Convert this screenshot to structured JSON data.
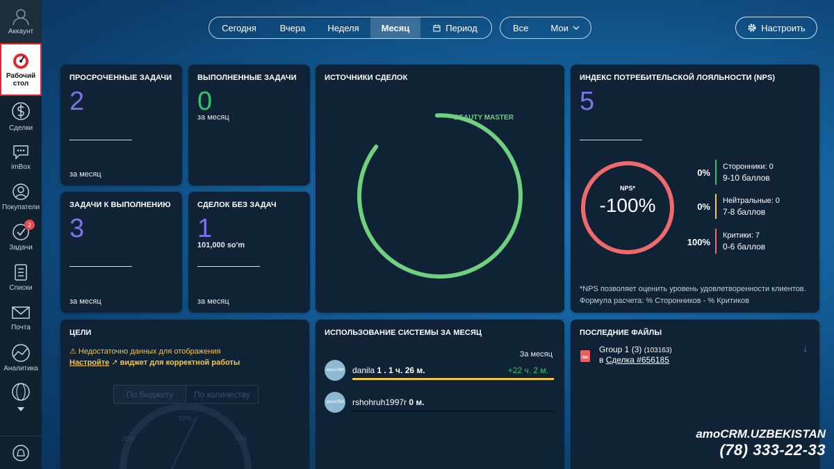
{
  "sidebar": {
    "account_label": "Аккаунт",
    "dashboard_label": "Рабочий\nстол",
    "deals_label": "Сделки",
    "imbox_label": "imBox",
    "buyers_label": "Покупатели",
    "tasks_label": "Задачи",
    "tasks_badge": "2",
    "lists_label": "Списки",
    "mail_label": "Почта",
    "analytics_label": "Аналитика"
  },
  "topbar": {
    "periods": [
      "Сегодня",
      "Вчера",
      "Неделя",
      "Месяц",
      "Период"
    ],
    "active_period": "Месяц",
    "filter_all": "Все",
    "filter_mine": "Мои",
    "settings_label": "Настроить"
  },
  "widgets": {
    "overdue": {
      "title": "ПРОСРОЧЕННЫЕ ЗАДАЧИ",
      "value": "2",
      "footer": "за месяц"
    },
    "completed": {
      "title": "ВЫПОЛНЕННЫЕ ЗАДАЧИ",
      "value": "0",
      "subtitle": "за месяц"
    },
    "to_do": {
      "title": "ЗАДАЧИ К ВЫПОЛНЕНИЮ",
      "value": "3",
      "footer": "за месяц"
    },
    "no_tasks": {
      "title": "СДЕЛОК БЕЗ ЗАДАЧ",
      "value": "1",
      "amount": "101,000 so'm",
      "footer": "за месяц"
    },
    "sources": {
      "title": "ИСТОЧНИКИ СДЕЛОК",
      "ring_label": "BEAUTY MASTER",
      "ring_share": 0.86,
      "ring_color": "#6fd07e"
    },
    "nps": {
      "title": "ИНДЕКС ПОТРЕБИТЕЛЬСКОЙ ЛОЯЛЬНОСТИ (NPS)",
      "value": "5",
      "gauge_label": "NPS*",
      "gauge_value": "-100%",
      "rows": [
        {
          "pct": "0%",
          "name": "Сторонники: 0",
          "range": "9-10 баллов",
          "color": "#33c76d"
        },
        {
          "pct": "0%",
          "name": "Нейтральные: 0",
          "range": "7-8 баллов",
          "color": "#f2c94c"
        },
        {
          "pct": "100%",
          "name": "Критики: 7",
          "range": "0-6 баллов",
          "color": "#ef6b6b"
        }
      ],
      "note": "*NPS позволяет оценить уровень удовлетворенности клиентов.",
      "formula": "Формула расчета: % Сторонников - % Критиков"
    },
    "goals": {
      "title": "ЦЕЛИ",
      "warning": "Недостаточно данных для отображения",
      "link": "Настройте",
      "link_suffix": "виджет для корректной работы",
      "tab_budget": "По бюджету",
      "tab_count": "По количеству",
      "gauge_50": "50%",
      "gauge_25": "25%",
      "gauge_75": "75%"
    },
    "usage": {
      "title": "ИСПОЛЬЗОВАНИЕ СИСТЕМЫ ЗА МЕСЯЦ",
      "period_label": "За месяц",
      "users": [
        {
          "name": "danila",
          "time": "1 . 1 ч. 26 м.",
          "delta": "+22 ч. 2 м.",
          "progress": 1.0
        },
        {
          "name": "rshohruh1997r",
          "time": "0 м.",
          "delta": "",
          "progress": 0.0
        }
      ],
      "avatar_text": "amoCRM"
    },
    "files": {
      "title": "ПОСЛЕДНИЕ ФАЙЛЫ",
      "file_name": "Group 1 (3)",
      "file_id": "(103163)",
      "file_ext": "IMG",
      "in_label": "в",
      "deal_link": "Сделка #656185"
    }
  },
  "brand": {
    "logo": "amoCRM.UZBEKISTAN",
    "phone": "(78) 333-22-33"
  }
}
